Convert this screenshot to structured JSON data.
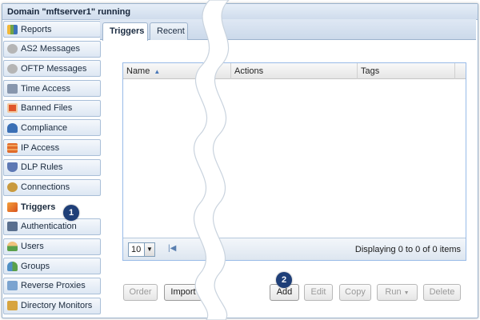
{
  "window": {
    "title": "Domain \"mftserver1\" running"
  },
  "sidebar": {
    "items": [
      {
        "label": "Reports",
        "icon": "reports-icon",
        "color": "#e7a92d"
      },
      {
        "label": "AS2 Messages",
        "icon": "as2-messages-icon",
        "color": "#a6a6a6"
      },
      {
        "label": "OFTP Messages",
        "icon": "oftp-messages-icon",
        "color": "#a6a6a6"
      },
      {
        "label": "Time Access",
        "icon": "time-access-icon",
        "color": "#7f8fa8"
      },
      {
        "label": "Banned Files",
        "icon": "banned-files-icon",
        "color": "#e0562b"
      },
      {
        "label": "Compliance",
        "icon": "compliance-icon",
        "color": "#3a6fb5"
      },
      {
        "label": "IP Access",
        "icon": "ip-access-icon",
        "color": "#e06b2a"
      },
      {
        "label": "DLP Rules",
        "icon": "dlp-rules-icon",
        "color": "#5d78b4"
      },
      {
        "label": "Connections",
        "icon": "connections-icon",
        "color": "#c99a3e"
      },
      {
        "label": "Triggers",
        "icon": "triggers-icon",
        "color": "#e26b25",
        "active": true
      },
      {
        "label": "Authentication",
        "icon": "authentication-icon",
        "color": "#5a6f8e"
      },
      {
        "label": "Users",
        "icon": "users-icon",
        "color": "#5aa04a"
      },
      {
        "label": "Groups",
        "icon": "groups-icon",
        "color": "#4f8fc4"
      },
      {
        "label": "Reverse Proxies",
        "icon": "reverse-proxies-icon",
        "color": "#7aa3d0"
      },
      {
        "label": "Directory Monitors",
        "icon": "directory-monitors-icon",
        "color": "#d7a440"
      }
    ]
  },
  "tabs": [
    {
      "label": "Triggers",
      "active": true
    },
    {
      "label": "Recent",
      "active": false
    }
  ],
  "grid": {
    "columns": [
      "Name",
      "Actions",
      "Tags"
    ],
    "sort_indicator": "▲",
    "page_size": "10",
    "first_page_icon": "first-page-icon",
    "display_text": "Displaying 0 to 0 of 0 items"
  },
  "buttons": {
    "order": "Order",
    "import": "Import",
    "add": "Add",
    "edit": "Edit",
    "copy": "Copy",
    "run": "Run",
    "run_caret": "▼",
    "delete": "Delete"
  },
  "callouts": {
    "one": "1",
    "two": "2"
  },
  "colors": {
    "callout": "#1f3f78",
    "accent": "#99bbe8"
  }
}
